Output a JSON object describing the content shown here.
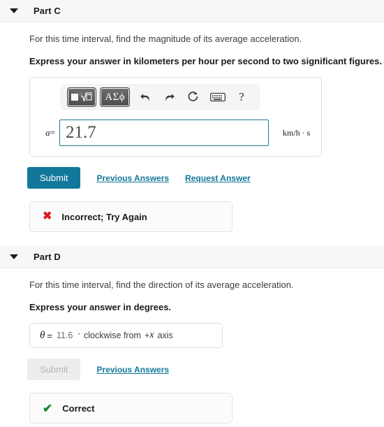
{
  "parts": [
    {
      "header_label": "Part C",
      "caret_icon": "triangle-down-icon",
      "prompt": "For this time interval, find the magnitude of its average acceleration.",
      "instruction": "Express your answer in kilometers per hour per second to two significant figures.",
      "math_toolbar": {
        "template_button_label": "√",
        "template_icon": "math-template-radical-icon",
        "greek_button_label": "ΑΣϕ",
        "undo_icon": "undo-arrow-icon",
        "redo_icon": "redo-arrow-icon",
        "reset_icon": "reset-circular-arrow-icon",
        "keyboard_icon": "keyboard-icon",
        "help_label": "?"
      },
      "answer": {
        "variable": "a",
        "equals": "=",
        "value": "21.7",
        "placeholder": "",
        "units": "km/h · s"
      },
      "submit_label": "Submit",
      "submit_disabled": false,
      "links": [
        "Previous Answers",
        "Request Answer"
      ],
      "feedback": {
        "status": "incorrect",
        "icon": "red-x-icon",
        "glyph": "✖",
        "text": "Incorrect; Try Again",
        "color": "#d81d26"
      }
    },
    {
      "header_label": "Part D",
      "caret_icon": "triangle-down-icon",
      "prompt": "For this time interval, find the direction of its average acceleration.",
      "instruction": "Express your answer in degrees.",
      "answer": {
        "variable": "θ",
        "equals": "=",
        "value": "11.6",
        "degree_symbol": "°",
        "tail_text_before_axis": "clockwise from",
        "axis_sign": "+",
        "axis_variable": "x",
        "tail_text_after_axis": "axis"
      },
      "submit_label": "Submit",
      "submit_disabled": true,
      "links": [
        "Previous Answers"
      ],
      "feedback": {
        "status": "correct",
        "icon": "green-check-icon",
        "glyph": "✔",
        "text": "Correct",
        "color": "#0f8833"
      }
    }
  ],
  "theme": {
    "accent": "#12789b",
    "header_background": "#f7f7f7",
    "input_border": "#1b7b91",
    "correct_color": "#0f8833",
    "incorrect_color": "#d81d26"
  }
}
